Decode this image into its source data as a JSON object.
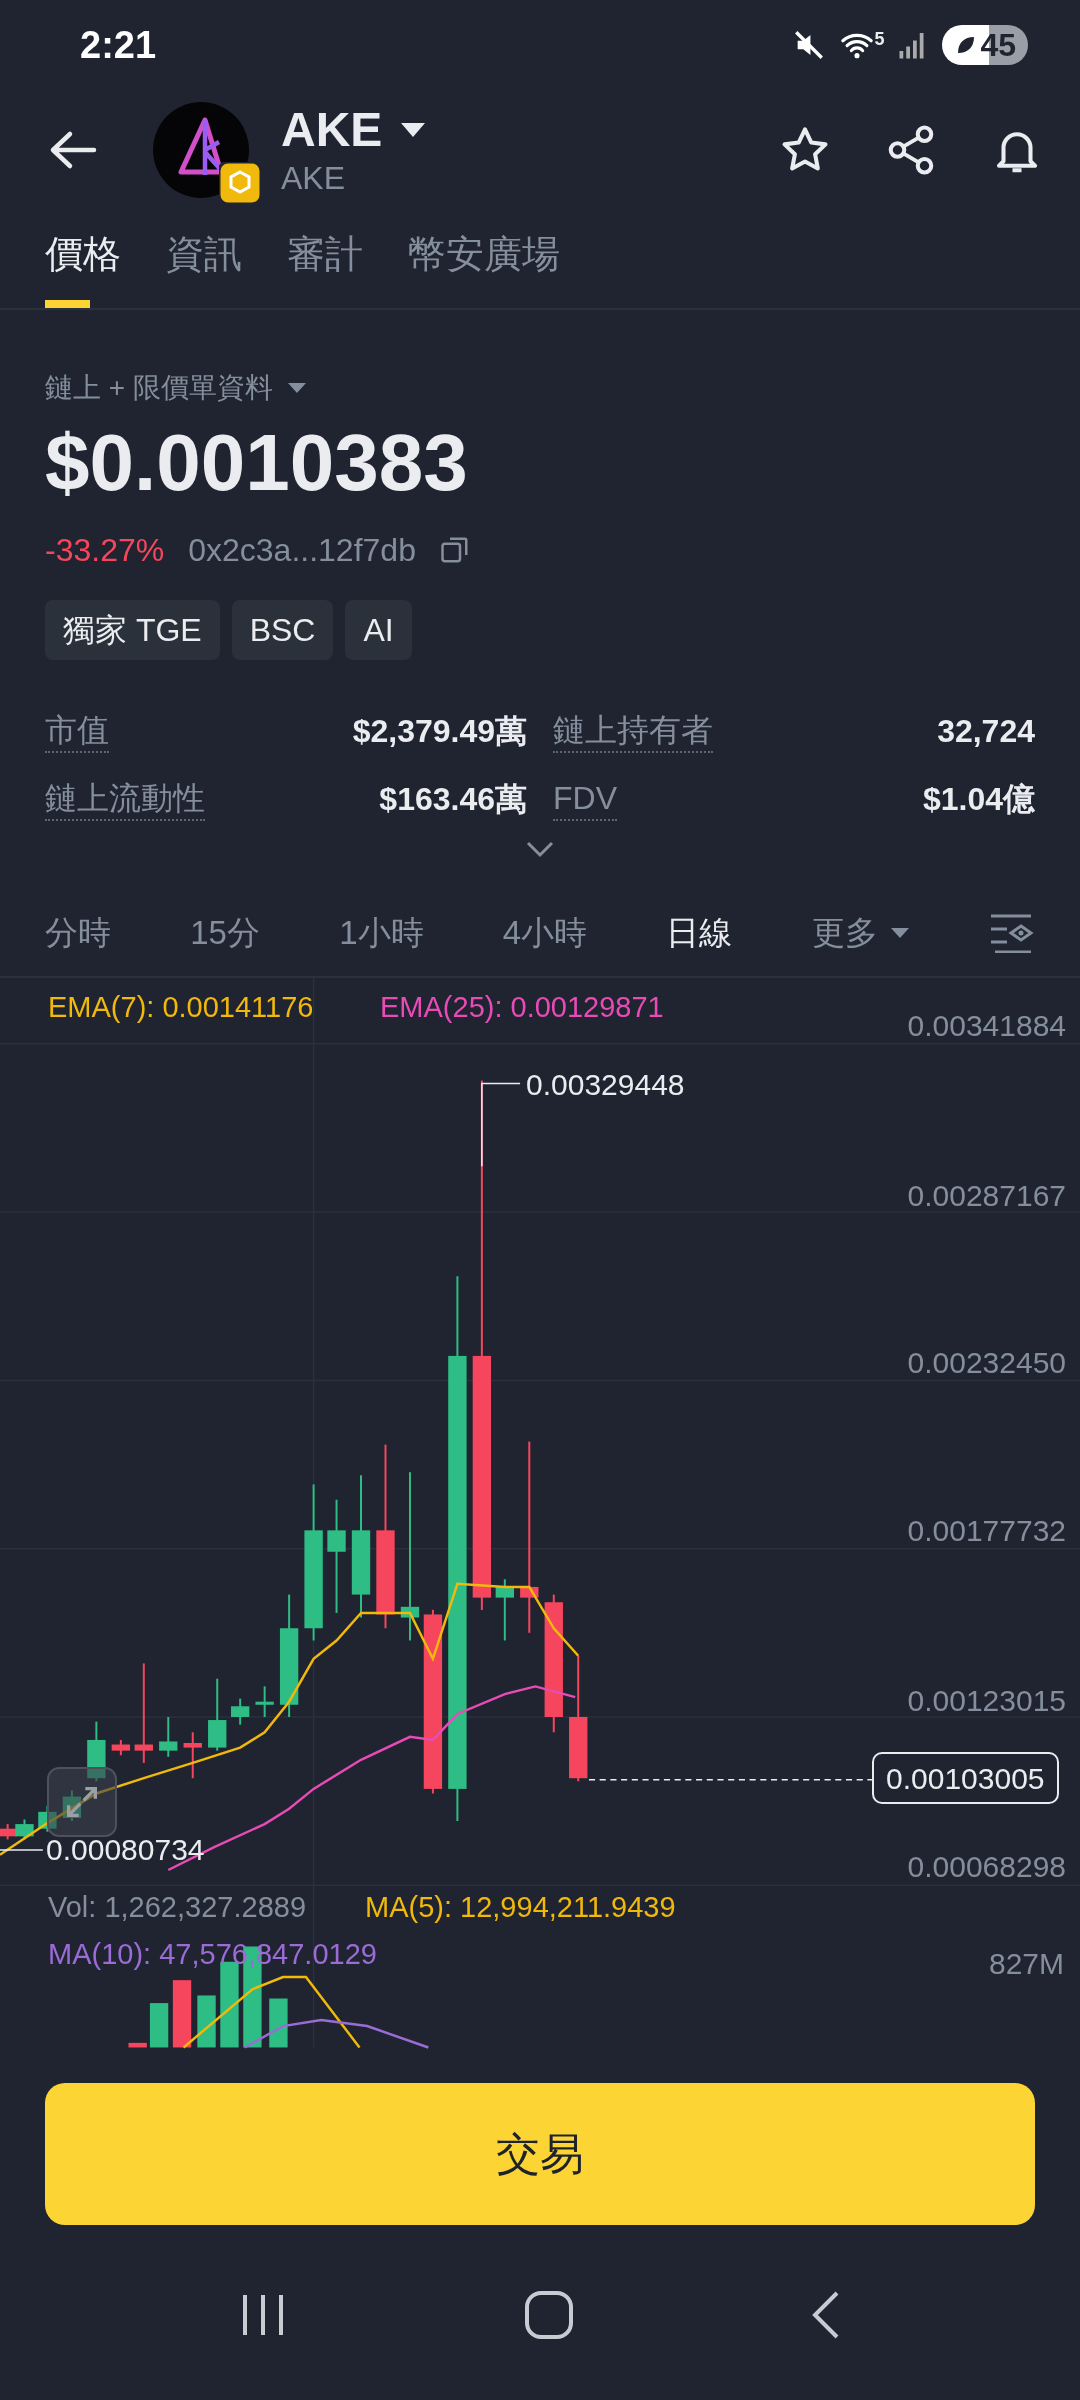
{
  "status_bar": {
    "time": "2:21",
    "wifi_label": "5",
    "battery": "45"
  },
  "header": {
    "symbol": "AKE",
    "name": "AKE"
  },
  "tabs": [
    {
      "label": "價格",
      "selected": true
    },
    {
      "label": "資訊",
      "selected": false
    },
    {
      "label": "審計",
      "selected": false
    },
    {
      "label": "幣安廣場",
      "selected": false
    }
  ],
  "source_selector": "鏈上 + 限價單資料",
  "price": "$0.0010383",
  "change": "-33.27%",
  "contract": "0x2c3a...12f7db",
  "tags": [
    "獨家 TGE",
    "BSC",
    "AI"
  ],
  "stats": [
    {
      "label": "市值",
      "value": "$2,379.49萬"
    },
    {
      "label": "鏈上持有者",
      "value": "32,724"
    },
    {
      "label": "鏈上流動性",
      "value": "$163.46萬"
    },
    {
      "label": "FDV",
      "value": "$1.04億"
    }
  ],
  "intervals": [
    {
      "label": "分時",
      "selected": false
    },
    {
      "label": "15分",
      "selected": false
    },
    {
      "label": "1小時",
      "selected": false
    },
    {
      "label": "4小時",
      "selected": false
    },
    {
      "label": "日線",
      "selected": true
    }
  ],
  "more_menu": "更多",
  "chart": {
    "ema7": "EMA(7): 0.00141176",
    "ema25": "EMA(25): 0.00129871",
    "price_axis": [
      "0.00341884",
      "0.00287167",
      "0.00232450",
      "0.00177732",
      "0.00123015",
      "0.00068298"
    ],
    "high_label": "0.00329448",
    "low_label": "0.00080734",
    "last_price": "0.00103005",
    "volume": "Vol: 1,262,327.2889",
    "ma5": "MA(5): 12,994,211.9439",
    "ma10": "MA(10): 47,576,847.0129",
    "volume_axis": "827M"
  },
  "trade_button": "交易"
}
